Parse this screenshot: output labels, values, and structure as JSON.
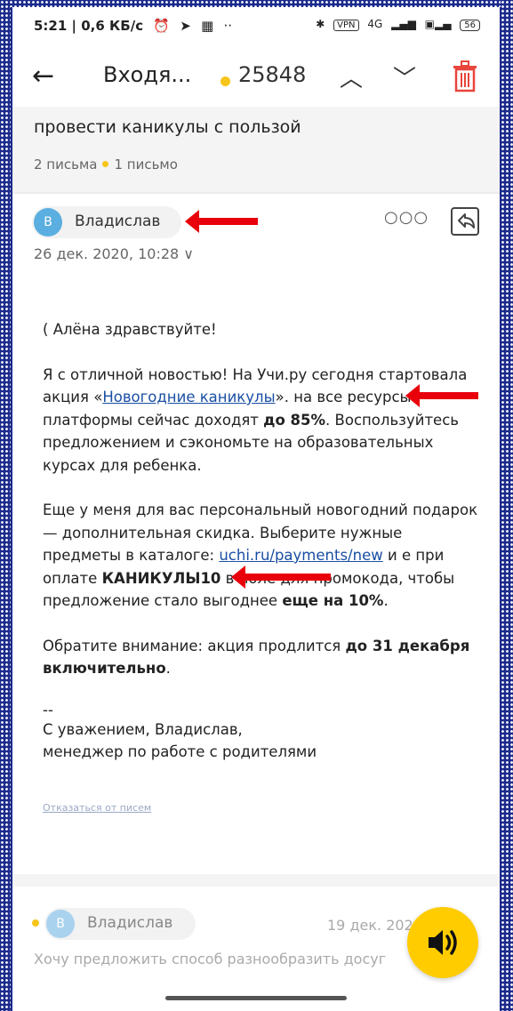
{
  "status_bar": {
    "time_speed": "5:21 | 0,6 КБ/с",
    "vpn": "VPN",
    "signal": "4G",
    "battery": "56"
  },
  "top_bar": {
    "title": "Входя...",
    "unread_count": "25848"
  },
  "thread": {
    "subject": "провести каникулы с пользой",
    "letters": "2 письма",
    "letters_unread": "1 письмо"
  },
  "message": {
    "avatar_letter": "В",
    "sender": "Владислав",
    "date": "26 дек. 2020, 10:28",
    "greeting": "Алёна здравствуйте!",
    "p1_a": "Я с отличной новостью! На Учи.ру сегодня стартовала акция «",
    "p1_link": "Новогодние каникулы",
    "p1_b": "».",
    "p1_c": "на все ресурсы платформы сейчас доходят ",
    "p1_bold": "до 85%",
    "p1_d": ". Воспользуйтесь предложением и сэкономьте на образовательных курсах для ребенка.",
    "p2_a": "Еще у меня для вас персональный новогодний подарок — дополнительная скидка. Выберите нужные предметы в каталоге: ",
    "p2_link": "uchi.ru/payments/new",
    "p2_b": " и",
    "p2_c": "е при оплате ",
    "p2_bold": "КАНИКУЛЫ10",
    "p2_d": " в поле для промокода, чтобы предложение стало выгоднее ",
    "p2_bold2": "еще на 10%",
    "p2_e": ".",
    "p3_a": "Обратите внимание: акция продлится ",
    "p3_bold": "до 31 декабря включительно",
    "p3_b": ".",
    "sig_dash": "--",
    "sig_line1": "С уважением, Владислав,",
    "sig_line2": "менеджер по работе с родителями",
    "unsubscribe": "Отказаться от писем"
  },
  "next_message": {
    "avatar_letter": "В",
    "sender": "Владислав",
    "date": "19 дек. 2020, 10:36",
    "preview": "Хочу предложить способ разнообразить досуг"
  },
  "colors": {
    "frame": "#1c2b8c",
    "accent_yellow": "#ffcc00",
    "link": "#1a4fa3",
    "arrow_red": "#e8000b",
    "trash_red": "#e8453c"
  }
}
